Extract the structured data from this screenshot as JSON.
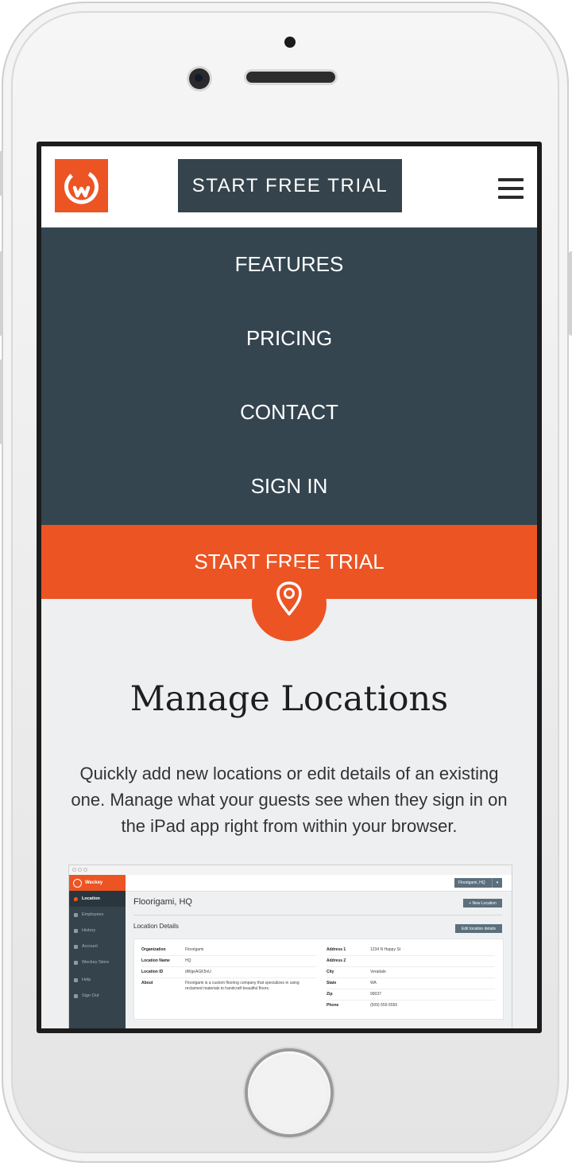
{
  "header": {
    "start_trial_label": "START FREE TRIAL"
  },
  "nav": {
    "items": [
      {
        "label": "FEATURES"
      },
      {
        "label": "PRICING"
      },
      {
        "label": "CONTACT"
      },
      {
        "label": "SIGN IN"
      }
    ],
    "cta_label": "START FREE TRIAL"
  },
  "content": {
    "title": "Manage Locations",
    "description": "Quickly add new locations or edit details of an existing one. Manage what your guests see when they sign in on the iPad app right from within your browser."
  },
  "app_preview": {
    "brand": "Weckey",
    "sidebar": [
      {
        "label": "Location",
        "active": true
      },
      {
        "label": "Employees",
        "active": false
      },
      {
        "label": "History",
        "active": false
      },
      {
        "label": "Account",
        "active": false
      },
      {
        "label": "Weckey Store",
        "active": false
      },
      {
        "label": "Help",
        "active": false
      },
      {
        "label": "Sign Out",
        "active": false
      }
    ],
    "org_selector": "Floorigami, HQ",
    "page_title": "Floorigami, HQ",
    "new_location_label": "+ New Location",
    "section_title": "Location Details",
    "edit_label": "Edit location details",
    "left_fields": [
      {
        "key": "Organization",
        "value": "Floorigami"
      },
      {
        "key": "Location Name",
        "value": "HQ"
      },
      {
        "key": "Location ID",
        "value": "dWgeAGK5nU"
      },
      {
        "key": "About",
        "value": "Floorigami is a custom flooring company that specializes in using reclaimed materials to handcraft beautiful floors."
      }
    ],
    "right_fields": [
      {
        "key": "Address 1",
        "value": "1234 N Happy St"
      },
      {
        "key": "Address 2",
        "value": ""
      },
      {
        "key": "City",
        "value": "Veradale"
      },
      {
        "key": "State",
        "value": "WA"
      },
      {
        "key": "Zip",
        "value": "99037"
      },
      {
        "key": "Phone",
        "value": "(509) 555-5555"
      }
    ]
  },
  "colors": {
    "brand_orange": "#ec5424",
    "dark_slate": "#344550",
    "page_bg": "#eeeff0"
  }
}
